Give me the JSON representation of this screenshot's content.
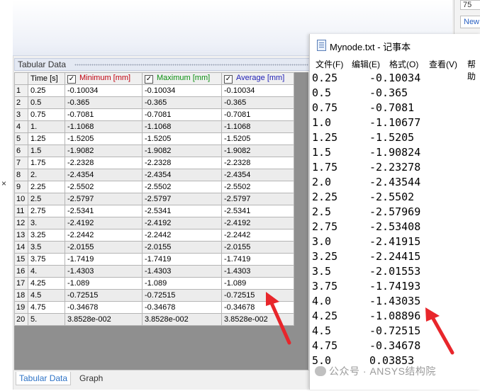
{
  "ansys": {
    "top_right_value": "75",
    "new_button": "New",
    "panel_title": "Tabular Data",
    "close_mark": "×",
    "columns": [
      "Time [s]",
      "Minimum [mm]",
      "Maximum [mm]",
      "Average [mm]"
    ],
    "rows": [
      [
        "1",
        "0.25",
        "-0.10034",
        "-0.10034",
        "-0.10034"
      ],
      [
        "2",
        "0.5",
        "-0.365",
        "-0.365",
        "-0.365"
      ],
      [
        "3",
        "0.75",
        "-0.7081",
        "-0.7081",
        "-0.7081"
      ],
      [
        "4",
        "1.",
        "-1.1068",
        "-1.1068",
        "-1.1068"
      ],
      [
        "5",
        "1.25",
        "-1.5205",
        "-1.5205",
        "-1.5205"
      ],
      [
        "6",
        "1.5",
        "-1.9082",
        "-1.9082",
        "-1.9082"
      ],
      [
        "7",
        "1.75",
        "-2.2328",
        "-2.2328",
        "-2.2328"
      ],
      [
        "8",
        "2.",
        "-2.4354",
        "-2.4354",
        "-2.4354"
      ],
      [
        "9",
        "2.25",
        "-2.5502",
        "-2.5502",
        "-2.5502"
      ],
      [
        "10",
        "2.5",
        "-2.5797",
        "-2.5797",
        "-2.5797"
      ],
      [
        "11",
        "2.75",
        "-2.5341",
        "-2.5341",
        "-2.5341"
      ],
      [
        "12",
        "3.",
        "-2.4192",
        "-2.4192",
        "-2.4192"
      ],
      [
        "13",
        "3.25",
        "-2.2442",
        "-2.2442",
        "-2.2442"
      ],
      [
        "14",
        "3.5",
        "-2.0155",
        "-2.0155",
        "-2.0155"
      ],
      [
        "15",
        "3.75",
        "-1.7419",
        "-1.7419",
        "-1.7419"
      ],
      [
        "16",
        "4.",
        "-1.4303",
        "-1.4303",
        "-1.4303"
      ],
      [
        "17",
        "4.25",
        "-1.089",
        "-1.089",
        "-1.089"
      ],
      [
        "18",
        "4.5",
        "-0.72515",
        "-0.72515",
        "-0.72515"
      ],
      [
        "19",
        "4.75",
        "-0.34678",
        "-0.34678",
        "-0.34678"
      ],
      [
        "20",
        "5.",
        "3.8528e-002",
        "3.8528e-002",
        "3.8528e-002"
      ]
    ],
    "tabs": [
      "Tabular Data",
      "Graph"
    ]
  },
  "notepad": {
    "title": "Mynode.txt - 记事本",
    "menu": [
      "文件(F)",
      "编辑(E)",
      "格式(O)",
      "查看(V)",
      "帮助"
    ],
    "lines": [
      [
        "0.25",
        "-0.10034"
      ],
      [
        "0.5",
        "-0.365"
      ],
      [
        "0.75",
        "-0.7081"
      ],
      [
        "1.0",
        "-1.10677"
      ],
      [
        "1.25",
        "-1.5205"
      ],
      [
        "1.5",
        "-1.90824"
      ],
      [
        "1.75",
        "-2.23278"
      ],
      [
        "2.0",
        "-2.43544"
      ],
      [
        "2.25",
        "-2.5502"
      ],
      [
        "2.5",
        "-2.57969"
      ],
      [
        "2.75",
        "-2.53408"
      ],
      [
        "3.0",
        "-2.41915"
      ],
      [
        "3.25",
        "-2.24415"
      ],
      [
        "3.5",
        "-2.01553"
      ],
      [
        "3.75",
        "-1.74193"
      ],
      [
        "4.0",
        "-1.43035"
      ],
      [
        "4.25",
        "-1.08896"
      ],
      [
        "4.5",
        "-0.72515"
      ],
      [
        "4.75",
        "-0.34678"
      ],
      [
        "5.0",
        "0.03853"
      ]
    ]
  },
  "watermark": "公众号 · ANSYS结构院",
  "accent_colors": {
    "minimum": "#c0000e",
    "maximum": "#0a8f10",
    "average": "#1d1db5",
    "arrow": "#e8262b",
    "tab_active": "#2e73c6"
  }
}
